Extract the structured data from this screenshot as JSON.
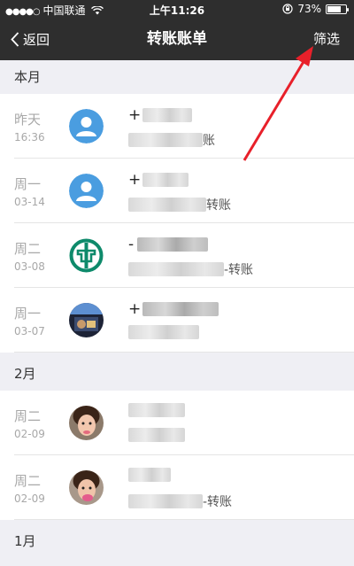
{
  "status_bar": {
    "carrier": "中国联通",
    "time": "上午11:26",
    "battery": "73%",
    "battery_level": 0.73
  },
  "nav": {
    "back_label": "返回",
    "title": "转账账单",
    "filter_label": "筛选"
  },
  "sections": [
    {
      "title": "本月"
    },
    {
      "title": "2月"
    },
    {
      "title": "1月"
    }
  ],
  "rows": [
    {
      "day": "昨天",
      "date": "16:36",
      "amount_prefix": "+",
      "desc_prefix": "",
      "desc_suffix": "账",
      "avatar": "default-avatar-icon"
    },
    {
      "day": "周一",
      "date": "03-14",
      "amount_prefix": "+",
      "desc_prefix": "",
      "desc_suffix": "转账",
      "avatar": "default-avatar-icon"
    },
    {
      "day": "周二",
      "date": "03-08",
      "amount_prefix": "-",
      "desc_prefix": "",
      "desc_suffix": "-转账",
      "avatar": "bank-logo-icon"
    },
    {
      "day": "周一",
      "date": "03-07",
      "amount_prefix": "+",
      "desc_prefix": "",
      "desc_suffix": "",
      "avatar": "photo-avatar"
    },
    {
      "day": "周二",
      "date": "02-09",
      "amount_prefix": "",
      "desc_prefix": "",
      "desc_suffix": "",
      "avatar": "photo-avatar"
    },
    {
      "day": "周二",
      "date": "02-09",
      "amount_prefix": "",
      "desc_prefix": "",
      "desc_suffix": "-转账",
      "avatar": "photo-avatar"
    }
  ],
  "colors": {
    "nav_bg": "#2e2e2e",
    "avatar_blue": "#4a9de0",
    "bank_green": "#0e8a6b",
    "arrow_red": "#e8202a"
  }
}
